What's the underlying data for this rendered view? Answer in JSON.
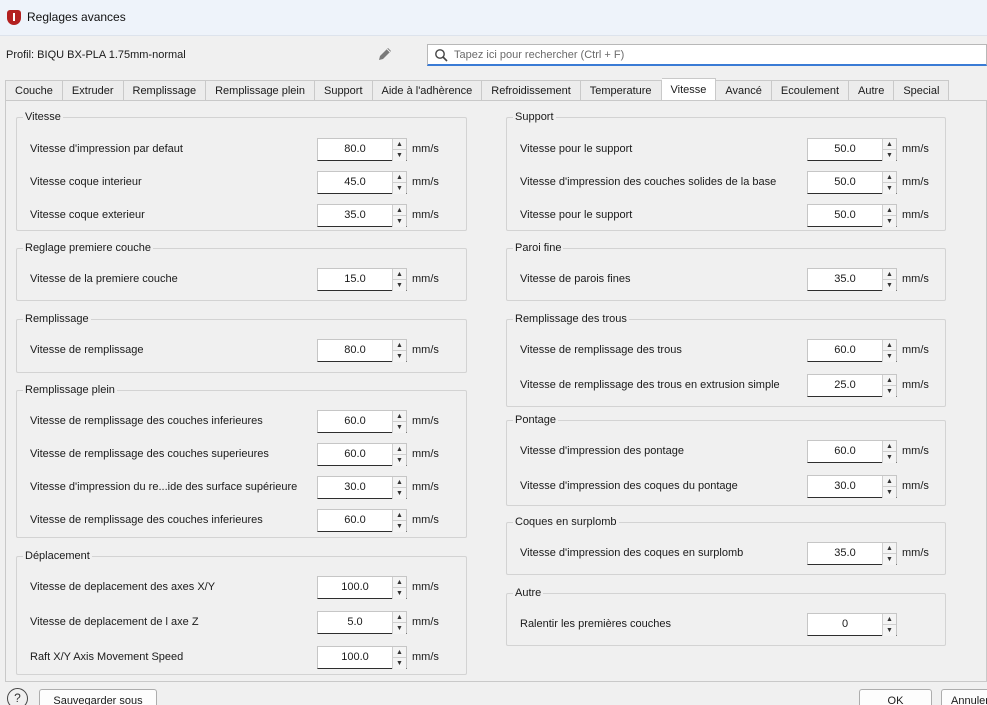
{
  "window": {
    "title": "Reglages avances"
  },
  "profile": {
    "label": "Profil: BIQU BX-PLA 1.75mm-normal"
  },
  "search": {
    "placeholder": "Tapez ici pour rechercher (Ctrl + F)"
  },
  "icons": {
    "edit": "pencil-icon",
    "search": "search-icon",
    "help": "help-icon",
    "app": "app-icon"
  },
  "tabs": [
    {
      "label": "Couche"
    },
    {
      "label": "Extruder"
    },
    {
      "label": "Remplissage"
    },
    {
      "label": "Remplissage plein"
    },
    {
      "label": "Support"
    },
    {
      "label": "Aide à l'adhèrence"
    },
    {
      "label": "Refroidissement"
    },
    {
      "label": "Temperature"
    },
    {
      "label": "Vitesse",
      "active": true
    },
    {
      "label": "Avancé"
    },
    {
      "label": "Ecoulement"
    },
    {
      "label": "Autre"
    },
    {
      "label": "Special"
    }
  ],
  "left_groups": [
    {
      "title": "Vitesse",
      "rows": [
        {
          "label": "Vitesse d'impression par defaut",
          "value": "80.0",
          "unit": "mm/s"
        },
        {
          "label": "Vitesse coque interieur",
          "value": "45.0",
          "unit": "mm/s"
        },
        {
          "label": "Vitesse coque exterieur",
          "value": "35.0",
          "unit": "mm/s"
        }
      ]
    },
    {
      "title": "Reglage premiere couche",
      "rows": [
        {
          "label": "Vitesse de la premiere couche",
          "value": "15.0",
          "unit": "mm/s"
        }
      ]
    },
    {
      "title": "Remplissage",
      "rows": [
        {
          "label": "Vitesse de remplissage",
          "value": "80.0",
          "unit": "mm/s"
        }
      ]
    },
    {
      "title": "Remplissage plein",
      "rows": [
        {
          "label": "Vitesse de remplissage des couches inferieures",
          "value": "60.0",
          "unit": "mm/s"
        },
        {
          "label": "Vitesse de remplissage des couches superieures",
          "value": "60.0",
          "unit": "mm/s"
        },
        {
          "label": "Vitesse d'impression du re...ide des surface supérieure",
          "value": "30.0",
          "unit": "mm/s"
        },
        {
          "label": "Vitesse de remplissage des couches inferieures",
          "value": "60.0",
          "unit": "mm/s"
        }
      ]
    },
    {
      "title": "Déplacement",
      "rows": [
        {
          "label": "Vitesse de deplacement des axes X/Y",
          "value": "100.0",
          "unit": "mm/s"
        },
        {
          "label": "Vitesse de deplacement de l axe Z",
          "value": "5.0",
          "unit": "mm/s"
        },
        {
          "label": "Raft X/Y Axis Movement Speed",
          "value": "100.0",
          "unit": "mm/s"
        }
      ]
    }
  ],
  "right_groups": [
    {
      "title": "Support",
      "rows": [
        {
          "label": "Vitesse pour le support",
          "value": "50.0",
          "unit": "mm/s"
        },
        {
          "label": "Vitesse d'impression des couches solides de la base",
          "value": "50.0",
          "unit": "mm/s"
        },
        {
          "label": "Vitesse pour le support",
          "value": "50.0",
          "unit": "mm/s"
        }
      ]
    },
    {
      "title": "Paroi fine",
      "rows": [
        {
          "label": "Vitesse de parois fines",
          "value": "35.0",
          "unit": "mm/s"
        }
      ]
    },
    {
      "title": "Remplissage des trous",
      "rows": [
        {
          "label": "Vitesse de remplissage des trous",
          "value": "60.0",
          "unit": "mm/s"
        },
        {
          "label": "Vitesse de remplissage des trous en extrusion simple",
          "value": "25.0",
          "unit": "mm/s"
        }
      ]
    },
    {
      "title": "Pontage",
      "rows": [
        {
          "label": "Vitesse d'impression des pontage",
          "value": "60.0",
          "unit": "mm/s"
        },
        {
          "label": "Vitesse d'impression des coques du pontage",
          "value": "30.0",
          "unit": "mm/s"
        }
      ]
    },
    {
      "title": "Coques en surplomb",
      "rows": [
        {
          "label": "Vitesse d'impression des coques en surplomb",
          "value": "35.0",
          "unit": "mm/s"
        }
      ]
    },
    {
      "title": "Autre",
      "rows": [
        {
          "label": "Ralentir les premières couches",
          "value": "0",
          "unit": ""
        }
      ]
    }
  ],
  "footer": {
    "help_glyph": "?",
    "save_as_label": "Sauvegarder sous",
    "ok_label": "OK",
    "cancel_label": "Annuler"
  }
}
